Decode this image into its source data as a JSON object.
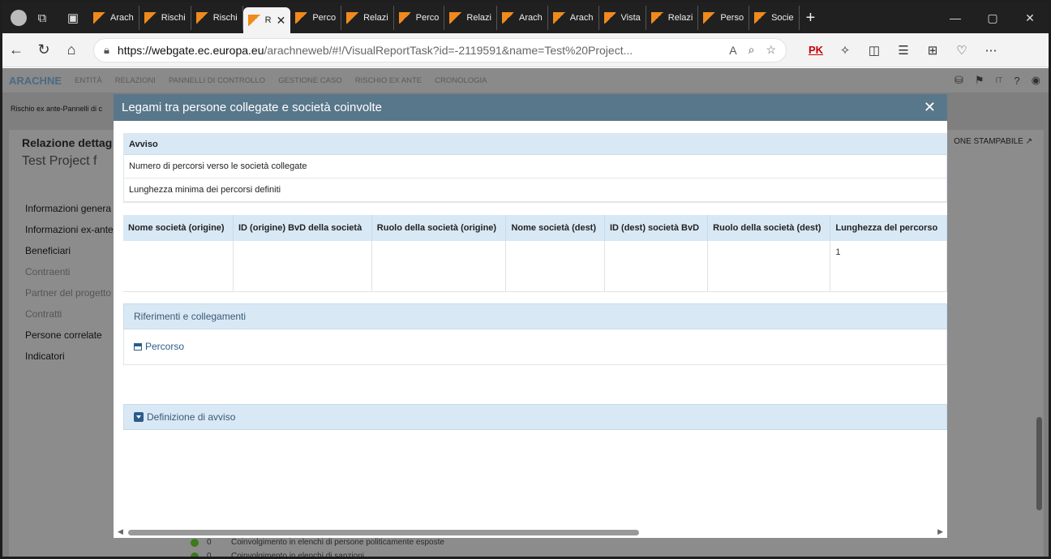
{
  "browser": {
    "tabs": [
      {
        "label": "Arach"
      },
      {
        "label": "Rischi"
      },
      {
        "label": "Rischi"
      },
      {
        "label": "R",
        "active": true
      },
      {
        "label": "Perco"
      },
      {
        "label": "Relazi"
      },
      {
        "label": "Perco"
      },
      {
        "label": "Relazi"
      },
      {
        "label": "Arach"
      },
      {
        "label": "Arach"
      },
      {
        "label": "Vista"
      },
      {
        "label": "Relazi"
      },
      {
        "label": "Perso"
      },
      {
        "label": "Socie"
      }
    ],
    "url_domain": "https://webgate.ec.europa.eu",
    "url_rest": "/arachneweb/#!/VisualReportTask?id=-2119591&name=Test%20Project...",
    "profile_badge": "PK"
  },
  "app": {
    "logo": "ARACHNE",
    "nav": [
      "ENTITÀ",
      "RELAZIONI",
      "PANNELLI DI CONTROLLO",
      "GESTIONE CASO",
      "RISCHIO EX ANTE",
      "CRONOLOGIA"
    ],
    "language": "IT",
    "breadcrumb": "Rischio ex ante-Pannelli di c",
    "report_title": "Relazione dettag",
    "report_subtitle": "Test Project f",
    "print_link": "ONE STAMPABILE",
    "side_menu": [
      {
        "label": "Informazioni genera",
        "dim": false
      },
      {
        "label": "Informazioni ex-ante",
        "dim": false
      },
      {
        "label": "Beneficiari",
        "dim": false
      },
      {
        "label": "Contraenti",
        "dim": true
      },
      {
        "label": "Partner del progetto",
        "dim": true
      },
      {
        "label": "Contratti",
        "dim": true
      },
      {
        "label": "Persone correlate",
        "dim": false
      },
      {
        "label": "Indicatori",
        "dim": false
      }
    ],
    "bottom_list": [
      {
        "count": "0",
        "label": "Coinvolgimento in elenchi di persone politicamente esposte"
      },
      {
        "count": "0",
        "label": "Coinvolgimento in elenchi di sanzioni"
      }
    ]
  },
  "modal": {
    "title": "Legami tra persone collegate e società coinvolte",
    "avviso_header": "Avviso",
    "avviso_rows": [
      "Numero di percorsi verso le società collegate",
      "Lunghezza minima dei percorsi definiti"
    ],
    "table": {
      "columns": [
        "Nome società (origine)",
        "ID (origine) BvD della società",
        "Ruolo della società (origine)",
        "Nome società (dest)",
        "ID (dest) società BvD",
        "Ruolo della società (dest)",
        "Lunghezza del percorso"
      ],
      "rows": [
        [
          "",
          "",
          "",
          "",
          "",
          "",
          "1"
        ]
      ]
    },
    "refs_header": "Riferimenti e collegamenti",
    "refs_link": "Percorso",
    "definition_header": "Definizione di avviso"
  }
}
